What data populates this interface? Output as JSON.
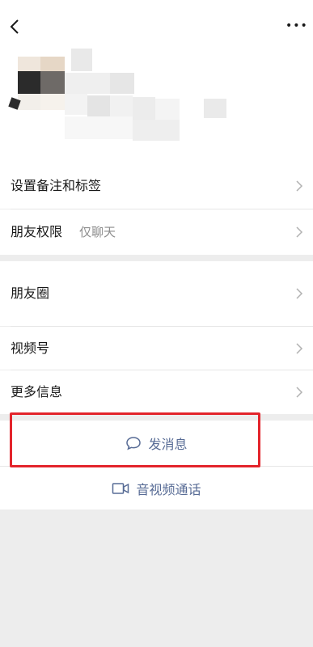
{
  "header": {
    "back_icon": "chevron-left-icon",
    "more_icon": "more-horizontal-icon",
    "more_label": "•••"
  },
  "menu": {
    "remark_tags": "设置备注和标签",
    "friend_permissions": "朋友权限",
    "friend_permissions_value": "仅聊天",
    "moments": "朋友圈",
    "channels": "视频号",
    "more_info": "更多信息"
  },
  "actions": {
    "send_message": "发消息",
    "send_message_icon": "chat-bubble-icon",
    "av_call": "音视频通话",
    "av_call_icon": "video-camera-icon"
  },
  "colors": {
    "link_blue": "#576b95",
    "highlight_red": "#e3242b",
    "page_gray": "#ededed"
  }
}
